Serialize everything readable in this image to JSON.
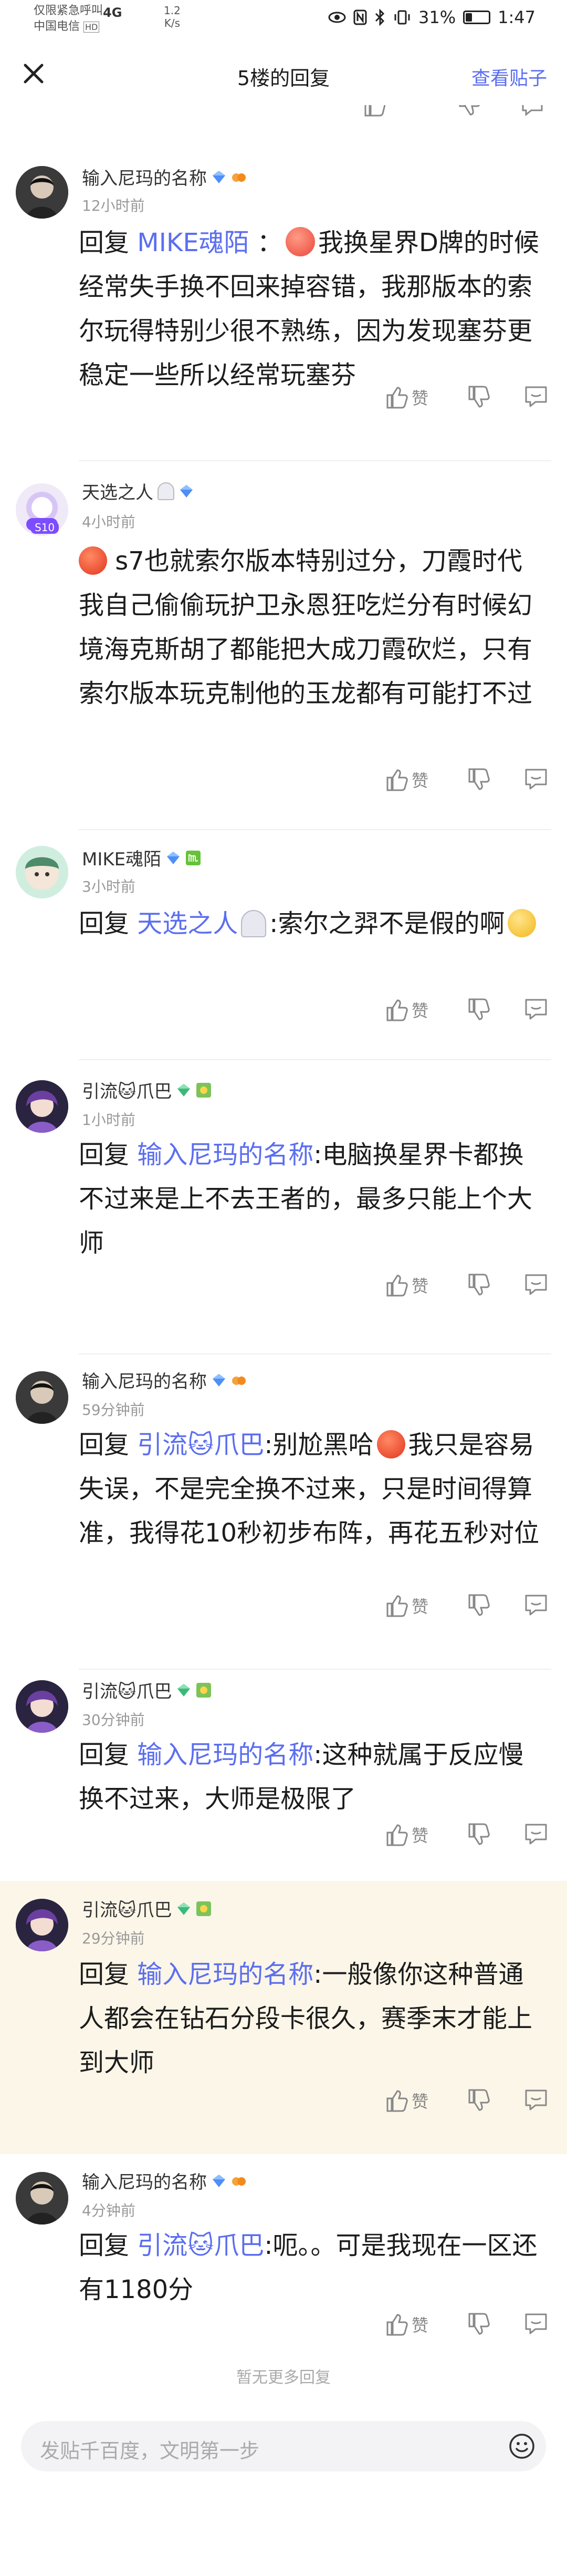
{
  "status_bar": {
    "carrier_line1": "仅限紧急呼叫",
    "carrier_line2": "中国电信",
    "hd_badge": "HD",
    "network": "4G",
    "speed_value": "1.2",
    "speed_unit": "K/s",
    "battery": "31%",
    "time": "1:47"
  },
  "nav": {
    "title": "5楼的回复",
    "view_post": "查看贴子"
  },
  "actions": {
    "like_label": "赞"
  },
  "comments": [
    {
      "username": "输入尼玛的名称",
      "time": "12小时前",
      "reply_prefix": "回复",
      "mention": "MIKE魂陌",
      "colon": " ：",
      "text": "我换星界D牌的时候经常失手换不回来掉容错，我那版本的索尔玩得特别少很不熟练，因为发现塞芬更稳定一些所以经常玩塞芬"
    },
    {
      "username": "天选之人",
      "time": "4小时前",
      "text": "s7也就索尔版本特别过分，刀霞时代我自己偷偷玩护卫永恩狂吃烂分有时候幻境海克斯胡了都能把大成刀霞砍烂，只有索尔版本玩克制他的玉龙都有可能打不过",
      "avatar_badge": "S10"
    },
    {
      "username": "MIKE魂陌",
      "time": "3小时前",
      "reply_prefix": "回复",
      "mention": "天选之人",
      "text": ":索尔之羿不是假的啊"
    },
    {
      "username": "引流🐱爪巴",
      "time": "1小时前",
      "reply_prefix": "回复",
      "mention": "输入尼玛的名称",
      "text": ":电脑换星界卡都换不过来是上不去王者的，最多只能上个大师"
    },
    {
      "username": "输入尼玛的名称",
      "time": "59分钟前",
      "reply_prefix": "回复",
      "mention": "引流🐱爪巴",
      "text_a": ":别尬黑哈",
      "text_b": "我只是容易失误，不是完全换不过来，只是时间得算准，我得花10秒初步布阵，再花五秒对位"
    },
    {
      "username": "引流🐱爪巴",
      "time": "30分钟前",
      "reply_prefix": "回复",
      "mention": "输入尼玛的名称",
      "text": ":这种就属于反应慢换不过来，大师是极限了"
    },
    {
      "username": "引流🐱爪巴",
      "time": "29分钟前",
      "reply_prefix": "回复",
      "mention": "输入尼玛的名称",
      "text": ":一般像你这种普通人都会在钻石分段卡很久，赛季末才能上到大师"
    },
    {
      "username": "输入尼玛的名称",
      "time": "4分钟前",
      "reply_prefix": "回复",
      "mention": "引流🐱爪巴",
      "text": ":呃。。可是我现在一区还有1180分"
    }
  ],
  "footer": {
    "no_more": "暂无更多回复",
    "input_placeholder": "发贴千百度，文明第一步"
  },
  "colors": {
    "accent": "#5b6ef0",
    "highlight_bg": "#fbf6e8",
    "muted": "#999999"
  }
}
